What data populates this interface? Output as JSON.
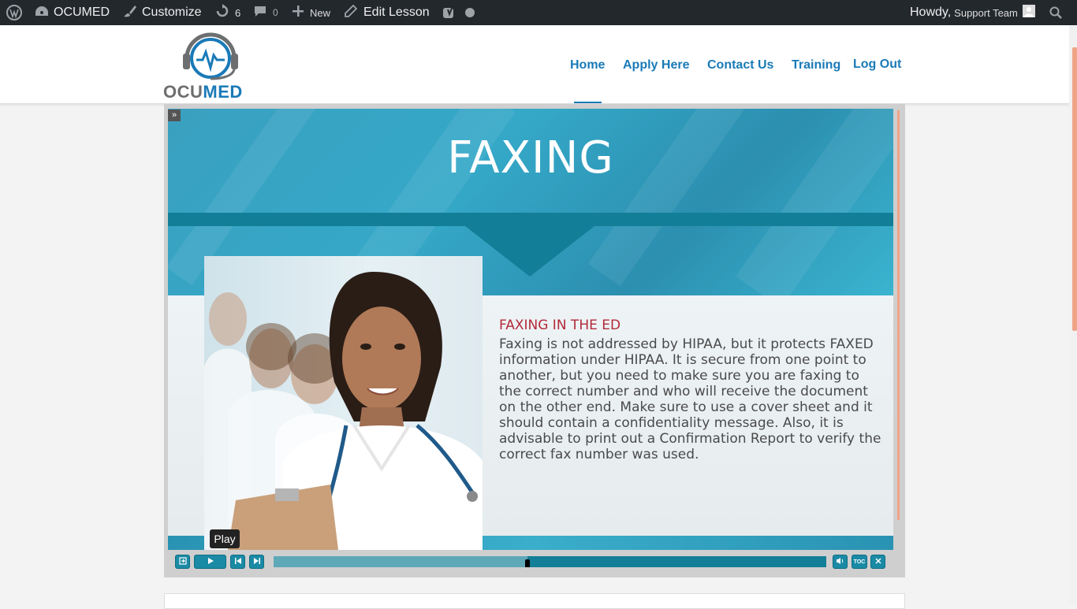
{
  "admin_bar": {
    "site_name": "OCUMED",
    "customize": "Customize",
    "updates_count": "6",
    "comments_count": "0",
    "new_label": "New",
    "edit_label": "Edit Lesson",
    "howdy": "Howdy,",
    "user_name": "Support Team"
  },
  "header": {
    "logo_text_part1": "OCU",
    "logo_text_part2": "MED",
    "nav": {
      "home": "Home",
      "apply": "Apply Here",
      "contact": "Contact Us",
      "training": "Training",
      "logout": "Log Out"
    },
    "active_item": "Home"
  },
  "slide": {
    "title": "FAXING",
    "heading": "FAXING IN THE ED",
    "body": "Faxing is not addressed by HIPAA, but it protects FAXED information under HIPAA. It is secure from one point to another, but you need to make sure you are faxing to the correct number and who will receive the document on the other end. Make sure to use a cover sheet and it should contain a confidentiality message. Also, it is advisable to print out a Confirmation Report to verify the correct fax number was used."
  },
  "player": {
    "tooltip": "Play",
    "toc_label": "TOC",
    "progress_fraction": 0.46
  },
  "colors": {
    "admin_bg": "#23282d",
    "nav_link": "#1a7ab8",
    "accent_orange": "#f0a487",
    "slide_teal": "#137e97",
    "heading_red": "#b22a3a"
  },
  "icons": [
    "wordpress-icon",
    "dashboard-icon",
    "brush-icon",
    "updates-icon",
    "comment-icon",
    "plus-icon",
    "pencil-icon",
    "yoast-icon",
    "status-dot-icon",
    "avatar-icon",
    "search-icon",
    "expand-icon",
    "exit-icon",
    "play-icon",
    "prev-icon",
    "next-icon",
    "volume-icon",
    "close-icon"
  ]
}
